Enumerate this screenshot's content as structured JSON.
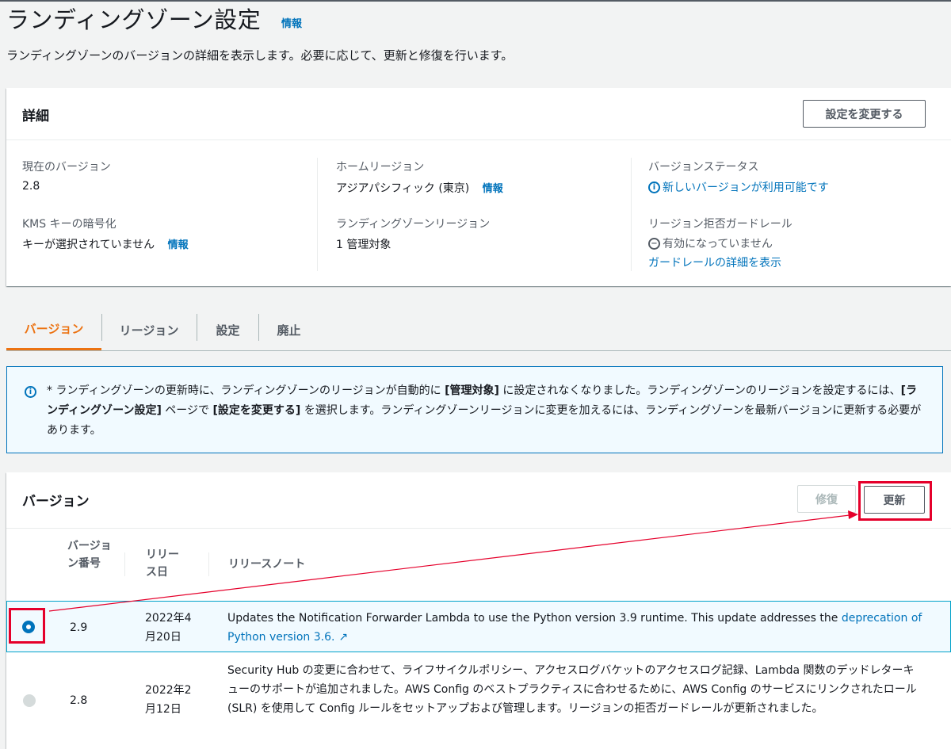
{
  "header": {
    "title": "ランディングゾーン設定",
    "info_link": "情報",
    "description": "ランディングゾーンのバージョンの詳細を表示します。必要に応じて、更新と修復を行います。"
  },
  "details": {
    "title": "詳細",
    "edit_button": "設定を変更する",
    "current_version_label": "現在のバージョン",
    "current_version_value": "2.8",
    "kms_label": "KMS キーの暗号化",
    "kms_value": "キーが選択されていません",
    "kms_info": "情報",
    "home_region_label": "ホームリージョン",
    "home_region_value": "アジアパシフィック (東京)",
    "home_region_info": "情報",
    "lz_region_label": "ランディングゾーンリージョン",
    "lz_region_value": "1 管理対象",
    "version_status_label": "バージョンステータス",
    "version_status_value": "新しいバージョンが利用可能です",
    "region_deny_label": "リージョン拒否ガードレール",
    "region_deny_value": "有効になっていません",
    "guardrail_link": "ガードレールの詳細を表示"
  },
  "tabs": [
    {
      "label": "バージョン",
      "active": true
    },
    {
      "label": "リージョン",
      "active": false
    },
    {
      "label": "設定",
      "active": false
    },
    {
      "label": "廃止",
      "active": false
    }
  ],
  "alert": {
    "t1": "* ランディングゾーンの更新時に、ランディングゾーンのリージョンが自動的に ",
    "b1": "[管理対象]",
    "t2": " に設定されなくなりました。ランディングゾーンのリージョンを設定するには、",
    "b2": "[ランディングゾーン設定]",
    "t3": " ページで ",
    "b3": "[設定を変更する]",
    "t4": " を選択します。ランディングゾーンリージョンに変更を加えるには、ランディングゾーンを最新バージョンに更新する必要があります。"
  },
  "versions": {
    "title": "バージョン",
    "repair_button": "修復",
    "update_button": "更新",
    "columns": {
      "version": "バージョン番号",
      "release_date": "リリース日",
      "notes": "リリースノート"
    },
    "rows": [
      {
        "version": "2.9",
        "date_line1": "2022年4",
        "date_line2": "月20日",
        "note_text": "Updates the Notification Forwarder Lambda to use the Python version 3.9 runtime. This update addresses the ",
        "note_link": "deprecation of Python version 3.6.",
        "selected": true
      },
      {
        "version": "2.8",
        "date_line1": "2022年2",
        "date_line2": "月12日",
        "note_text": "Security Hub の変更に合わせて、ライフサイクルポリシー、アクセスログバケットのアクセスログ記録、Lambda 関数のデッドレターキューのサポートが追加されました。AWS Config のベストプラクティスに合わせるために、AWS Config のサービスにリンクされたロール (SLR) を使用して Config ルールをセットアップおよび管理します。リージョンの拒否ガードレールが更新されました。",
        "selected": false
      }
    ]
  },
  "colors": {
    "accent": "#ec7211",
    "link": "#0073bb",
    "highlight": "#e5002b"
  }
}
